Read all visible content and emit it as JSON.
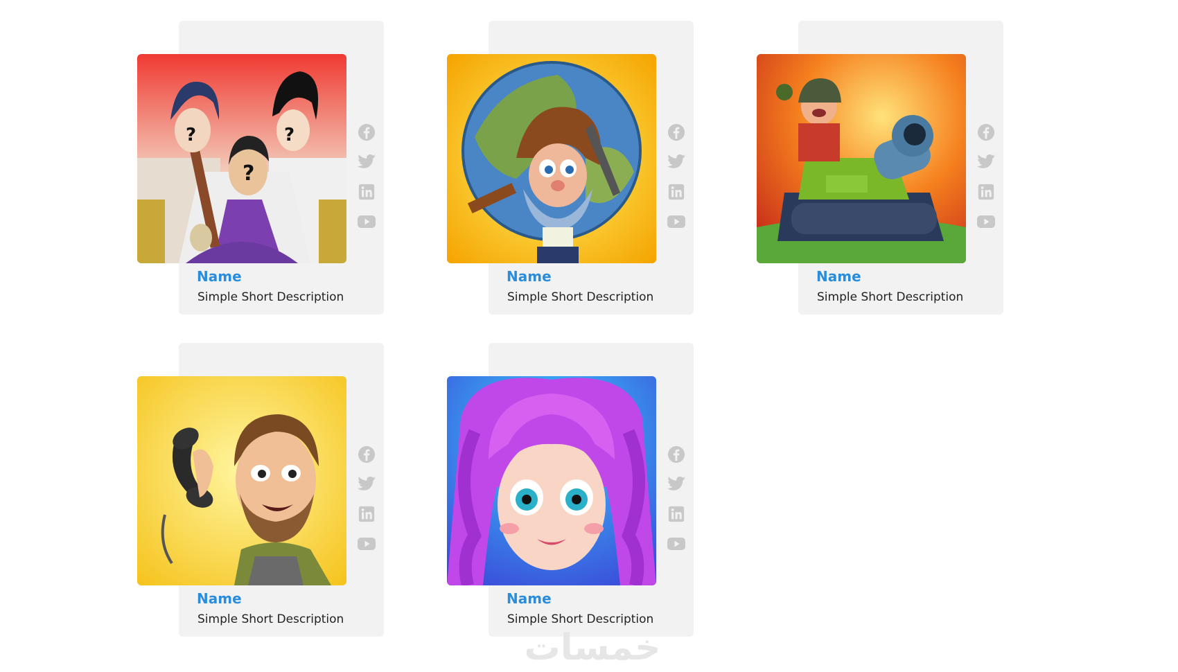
{
  "cards": [
    {
      "name": "Name",
      "description": "Simple Short Description",
      "image": "anime-characters-art"
    },
    {
      "name": "Name",
      "description": "Simple Short Description",
      "image": "dwarf-miner-globe-art"
    },
    {
      "name": "Name",
      "description": "Simple Short Description",
      "image": "tank-soldier-art"
    },
    {
      "name": "Name",
      "description": "Simple Short Description",
      "image": "man-with-phone-art"
    },
    {
      "name": "Name",
      "description": "Simple Short Description",
      "image": "purple-hair-girl-art"
    }
  ],
  "social_icons": [
    "facebook-icon",
    "twitter-icon",
    "linkedin-icon",
    "youtube-icon"
  ],
  "colors": {
    "card_bg": "#f2f2f2",
    "name_blue": "#2a8ddb",
    "icon_gray": "#c8c8c8"
  },
  "watermark": "خمسات"
}
